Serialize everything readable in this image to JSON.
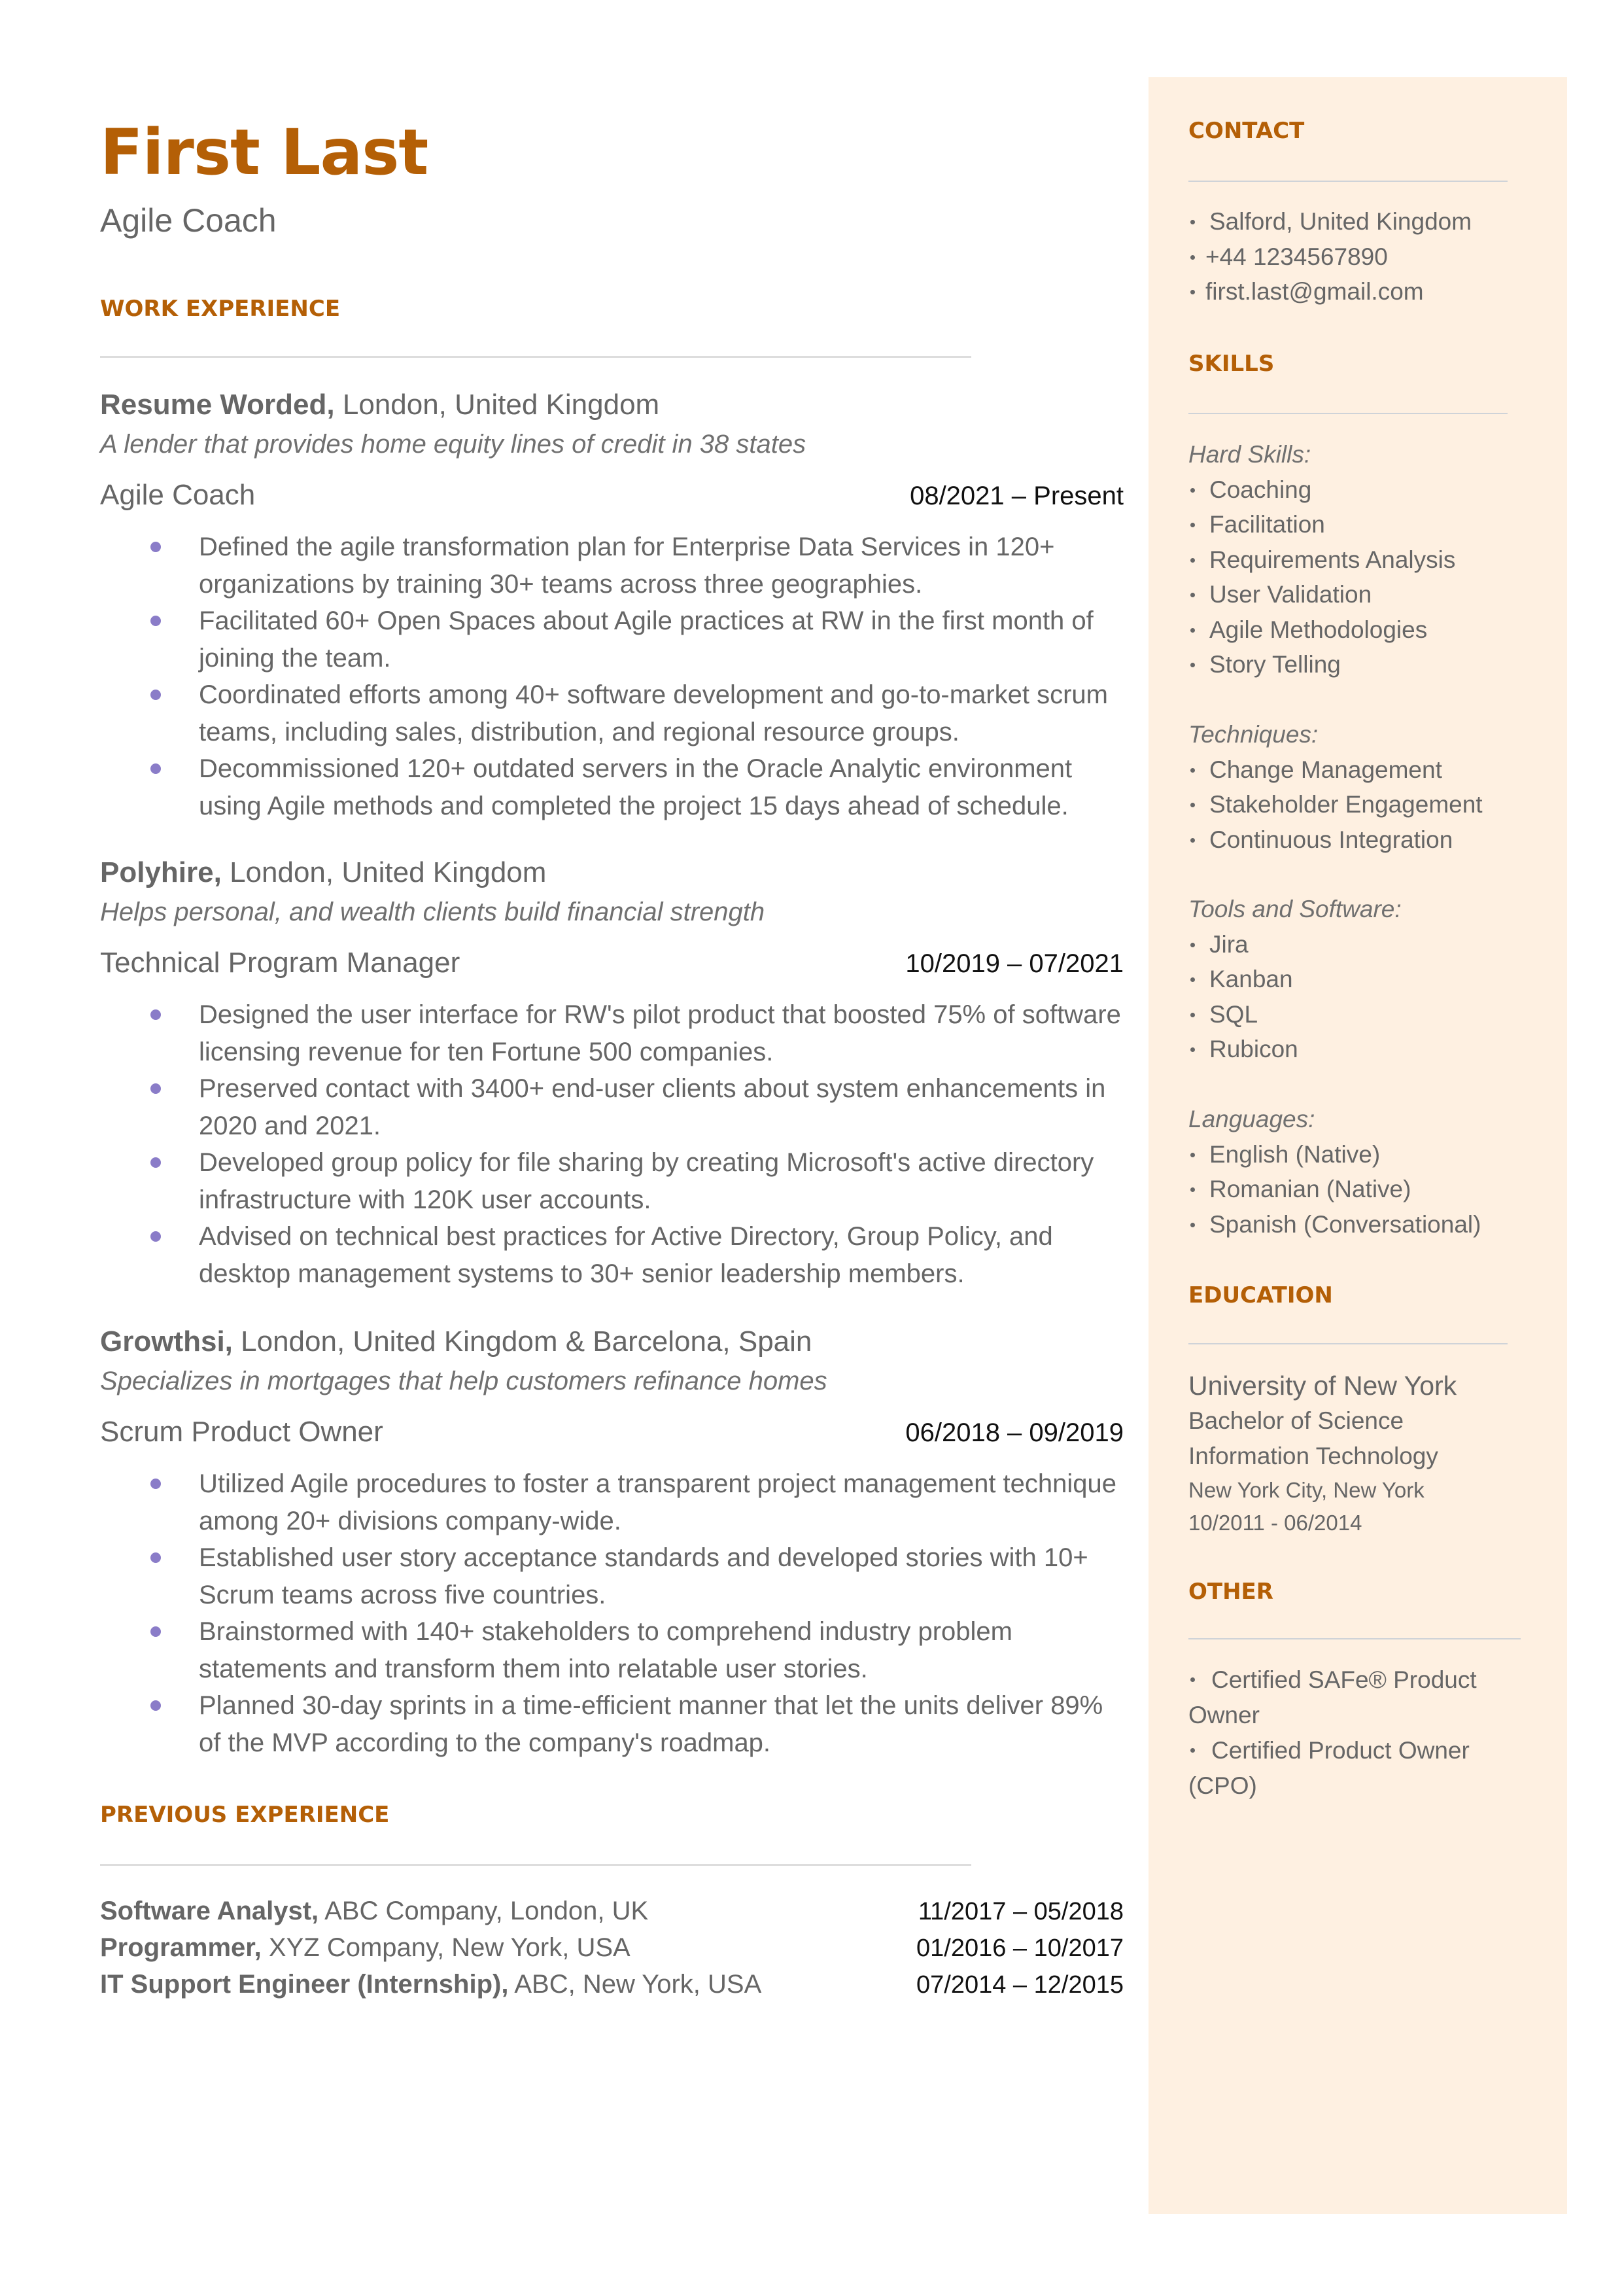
{
  "header": {
    "name": "First Last",
    "headline": "Agile Coach"
  },
  "colors": {
    "accent": "#B45F06",
    "sidebar_bg": "#FEF0E1",
    "bullet": "#8A7CC8",
    "body_text": "#666666"
  },
  "work_experience": {
    "title": "WORK EXPERIENCE",
    "jobs": [
      {
        "company": "Resume Worded,",
        "location": "London, United Kingdom",
        "tagline": "A lender that provides home equity lines of credit in 38 states",
        "role": "Agile Coach",
        "dates": "08/2021 – Present",
        "bullets": [
          "Defined the agile transformation plan for Enterprise Data Services in 120+ organizations by training 30+ teams across three geographies.",
          "Facilitated 60+ Open Spaces about Agile practices at RW in the first month of joining the team.",
          "Coordinated efforts among 40+ software development and go-to-market scrum teams, including sales, distribution, and regional resource groups.",
          "Decommissioned 120+ outdated servers in the Oracle Analytic environment using Agile methods and completed the project 15 days ahead of schedule."
        ]
      },
      {
        "company": "Polyhire,",
        "location": "London, United Kingdom",
        "tagline": "Helps personal, and wealth clients build financial strength",
        "role": "Technical Program Manager",
        "dates": "10/2019 – 07/2021",
        "bullets": [
          "Designed the user interface for RW's pilot product that boosted 75% of software licensing revenue for ten Fortune 500 companies.",
          "Preserved contact with 3400+ end-user clients about system enhancements in 2020 and 2021.",
          "Developed group policy for file sharing by creating Microsoft's active directory infrastructure with 120K user accounts.",
          "Advised on technical best practices for Active Directory, Group Policy, and desktop management systems to 30+ senior leadership members."
        ]
      },
      {
        "company": "Growthsi,",
        "location": "London, United Kingdom & Barcelona, Spain",
        "tagline": "Specializes in mortgages that help customers refinance homes",
        "role": "Scrum Product Owner",
        "dates": "06/2018 – 09/2019",
        "bullets": [
          "Utilized Agile procedures to foster a transparent project management technique among 20+ divisions company-wide.",
          "Established user story acceptance standards and developed stories with 10+ Scrum teams across five countries.",
          "Brainstormed with 140+ stakeholders to comprehend industry problem statements and transform them into relatable user stories.",
          "Planned 30-day sprints in a time-efficient manner that let the units deliver 89% of the MVP according to the company's roadmap."
        ]
      }
    ]
  },
  "previous_experience": {
    "title": "PREVIOUS EXPERIENCE",
    "rows": [
      {
        "role": "Software Analyst,",
        "detail": "ABC Company, London, UK",
        "dates": "11/2017 – 05/2018"
      },
      {
        "role": "Programmer,",
        "detail": "XYZ Company, New York, USA",
        "dates": "01/2016 – 10/2017"
      },
      {
        "role": "IT Support Engineer (Internship),",
        "detail": "ABC, New York, USA",
        "dates": "07/2014 – 12/2015"
      }
    ]
  },
  "sidebar": {
    "contact": {
      "title": "CONTACT",
      "items": [
        "Salford, United Kingdom",
        "+44 1234567890",
        "first.last@gmail.com"
      ]
    },
    "skills": {
      "title": "SKILLS",
      "groups": [
        {
          "label": "Hard Skills:",
          "items": [
            "Coaching",
            "Facilitation",
            "Requirements Analysis",
            "User Validation",
            "Agile Methodologies",
            "Story Telling"
          ]
        },
        {
          "label": "Techniques:",
          "items": [
            "Change Management",
            "Stakeholder Engagement",
            "Continuous Integration"
          ]
        },
        {
          "label": "Tools and Software:",
          "items": [
            "Jira",
            "Kanban",
            "SQL",
            "Rubicon"
          ]
        },
        {
          "label": "Languages:",
          "items": [
            "English (Native)",
            "Romanian (Native)",
            "Spanish (Conversational)"
          ]
        }
      ]
    },
    "education": {
      "title": "EDUCATION",
      "school": "University of New York",
      "degree": "Bachelor of Science",
      "field": "Information Technology",
      "location": "New York City, New York",
      "dates": "10/2011 - 06/2014"
    },
    "other": {
      "title": "OTHER",
      "items": [
        "Certified SAFe® Product Owner",
        "Certified Product Owner (CPO)"
      ]
    }
  }
}
